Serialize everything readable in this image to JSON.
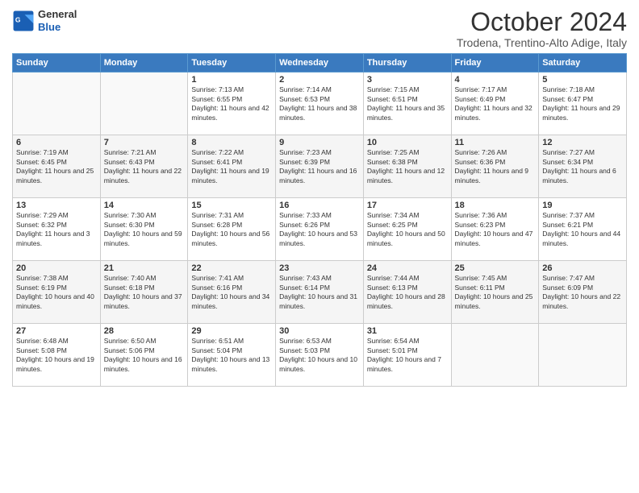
{
  "header": {
    "logo_line1": "General",
    "logo_line2": "Blue",
    "month_title": "October 2024",
    "location": "Trodena, Trentino-Alto Adige, Italy"
  },
  "days_of_week": [
    "Sunday",
    "Monday",
    "Tuesday",
    "Wednesday",
    "Thursday",
    "Friday",
    "Saturday"
  ],
  "weeks": [
    [
      {
        "day": "",
        "sunrise": "",
        "sunset": "",
        "daylight": ""
      },
      {
        "day": "",
        "sunrise": "",
        "sunset": "",
        "daylight": ""
      },
      {
        "day": "1",
        "sunrise": "Sunrise: 7:13 AM",
        "sunset": "Sunset: 6:55 PM",
        "daylight": "Daylight: 11 hours and 42 minutes."
      },
      {
        "day": "2",
        "sunrise": "Sunrise: 7:14 AM",
        "sunset": "Sunset: 6:53 PM",
        "daylight": "Daylight: 11 hours and 38 minutes."
      },
      {
        "day": "3",
        "sunrise": "Sunrise: 7:15 AM",
        "sunset": "Sunset: 6:51 PM",
        "daylight": "Daylight: 11 hours and 35 minutes."
      },
      {
        "day": "4",
        "sunrise": "Sunrise: 7:17 AM",
        "sunset": "Sunset: 6:49 PM",
        "daylight": "Daylight: 11 hours and 32 minutes."
      },
      {
        "day": "5",
        "sunrise": "Sunrise: 7:18 AM",
        "sunset": "Sunset: 6:47 PM",
        "daylight": "Daylight: 11 hours and 29 minutes."
      }
    ],
    [
      {
        "day": "6",
        "sunrise": "Sunrise: 7:19 AM",
        "sunset": "Sunset: 6:45 PM",
        "daylight": "Daylight: 11 hours and 25 minutes."
      },
      {
        "day": "7",
        "sunrise": "Sunrise: 7:21 AM",
        "sunset": "Sunset: 6:43 PM",
        "daylight": "Daylight: 11 hours and 22 minutes."
      },
      {
        "day": "8",
        "sunrise": "Sunrise: 7:22 AM",
        "sunset": "Sunset: 6:41 PM",
        "daylight": "Daylight: 11 hours and 19 minutes."
      },
      {
        "day": "9",
        "sunrise": "Sunrise: 7:23 AM",
        "sunset": "Sunset: 6:39 PM",
        "daylight": "Daylight: 11 hours and 16 minutes."
      },
      {
        "day": "10",
        "sunrise": "Sunrise: 7:25 AM",
        "sunset": "Sunset: 6:38 PM",
        "daylight": "Daylight: 11 hours and 12 minutes."
      },
      {
        "day": "11",
        "sunrise": "Sunrise: 7:26 AM",
        "sunset": "Sunset: 6:36 PM",
        "daylight": "Daylight: 11 hours and 9 minutes."
      },
      {
        "day": "12",
        "sunrise": "Sunrise: 7:27 AM",
        "sunset": "Sunset: 6:34 PM",
        "daylight": "Daylight: 11 hours and 6 minutes."
      }
    ],
    [
      {
        "day": "13",
        "sunrise": "Sunrise: 7:29 AM",
        "sunset": "Sunset: 6:32 PM",
        "daylight": "Daylight: 11 hours and 3 minutes."
      },
      {
        "day": "14",
        "sunrise": "Sunrise: 7:30 AM",
        "sunset": "Sunset: 6:30 PM",
        "daylight": "Daylight: 10 hours and 59 minutes."
      },
      {
        "day": "15",
        "sunrise": "Sunrise: 7:31 AM",
        "sunset": "Sunset: 6:28 PM",
        "daylight": "Daylight: 10 hours and 56 minutes."
      },
      {
        "day": "16",
        "sunrise": "Sunrise: 7:33 AM",
        "sunset": "Sunset: 6:26 PM",
        "daylight": "Daylight: 10 hours and 53 minutes."
      },
      {
        "day": "17",
        "sunrise": "Sunrise: 7:34 AM",
        "sunset": "Sunset: 6:25 PM",
        "daylight": "Daylight: 10 hours and 50 minutes."
      },
      {
        "day": "18",
        "sunrise": "Sunrise: 7:36 AM",
        "sunset": "Sunset: 6:23 PM",
        "daylight": "Daylight: 10 hours and 47 minutes."
      },
      {
        "day": "19",
        "sunrise": "Sunrise: 7:37 AM",
        "sunset": "Sunset: 6:21 PM",
        "daylight": "Daylight: 10 hours and 44 minutes."
      }
    ],
    [
      {
        "day": "20",
        "sunrise": "Sunrise: 7:38 AM",
        "sunset": "Sunset: 6:19 PM",
        "daylight": "Daylight: 10 hours and 40 minutes."
      },
      {
        "day": "21",
        "sunrise": "Sunrise: 7:40 AM",
        "sunset": "Sunset: 6:18 PM",
        "daylight": "Daylight: 10 hours and 37 minutes."
      },
      {
        "day": "22",
        "sunrise": "Sunrise: 7:41 AM",
        "sunset": "Sunset: 6:16 PM",
        "daylight": "Daylight: 10 hours and 34 minutes."
      },
      {
        "day": "23",
        "sunrise": "Sunrise: 7:43 AM",
        "sunset": "Sunset: 6:14 PM",
        "daylight": "Daylight: 10 hours and 31 minutes."
      },
      {
        "day": "24",
        "sunrise": "Sunrise: 7:44 AM",
        "sunset": "Sunset: 6:13 PM",
        "daylight": "Daylight: 10 hours and 28 minutes."
      },
      {
        "day": "25",
        "sunrise": "Sunrise: 7:45 AM",
        "sunset": "Sunset: 6:11 PM",
        "daylight": "Daylight: 10 hours and 25 minutes."
      },
      {
        "day": "26",
        "sunrise": "Sunrise: 7:47 AM",
        "sunset": "Sunset: 6:09 PM",
        "daylight": "Daylight: 10 hours and 22 minutes."
      }
    ],
    [
      {
        "day": "27",
        "sunrise": "Sunrise: 6:48 AM",
        "sunset": "Sunset: 5:08 PM",
        "daylight": "Daylight: 10 hours and 19 minutes."
      },
      {
        "day": "28",
        "sunrise": "Sunrise: 6:50 AM",
        "sunset": "Sunset: 5:06 PM",
        "daylight": "Daylight: 10 hours and 16 minutes."
      },
      {
        "day": "29",
        "sunrise": "Sunrise: 6:51 AM",
        "sunset": "Sunset: 5:04 PM",
        "daylight": "Daylight: 10 hours and 13 minutes."
      },
      {
        "day": "30",
        "sunrise": "Sunrise: 6:53 AM",
        "sunset": "Sunset: 5:03 PM",
        "daylight": "Daylight: 10 hours and 10 minutes."
      },
      {
        "day": "31",
        "sunrise": "Sunrise: 6:54 AM",
        "sunset": "Sunset: 5:01 PM",
        "daylight": "Daylight: 10 hours and 7 minutes."
      },
      {
        "day": "",
        "sunrise": "",
        "sunset": "",
        "daylight": ""
      },
      {
        "day": "",
        "sunrise": "",
        "sunset": "",
        "daylight": ""
      }
    ]
  ]
}
